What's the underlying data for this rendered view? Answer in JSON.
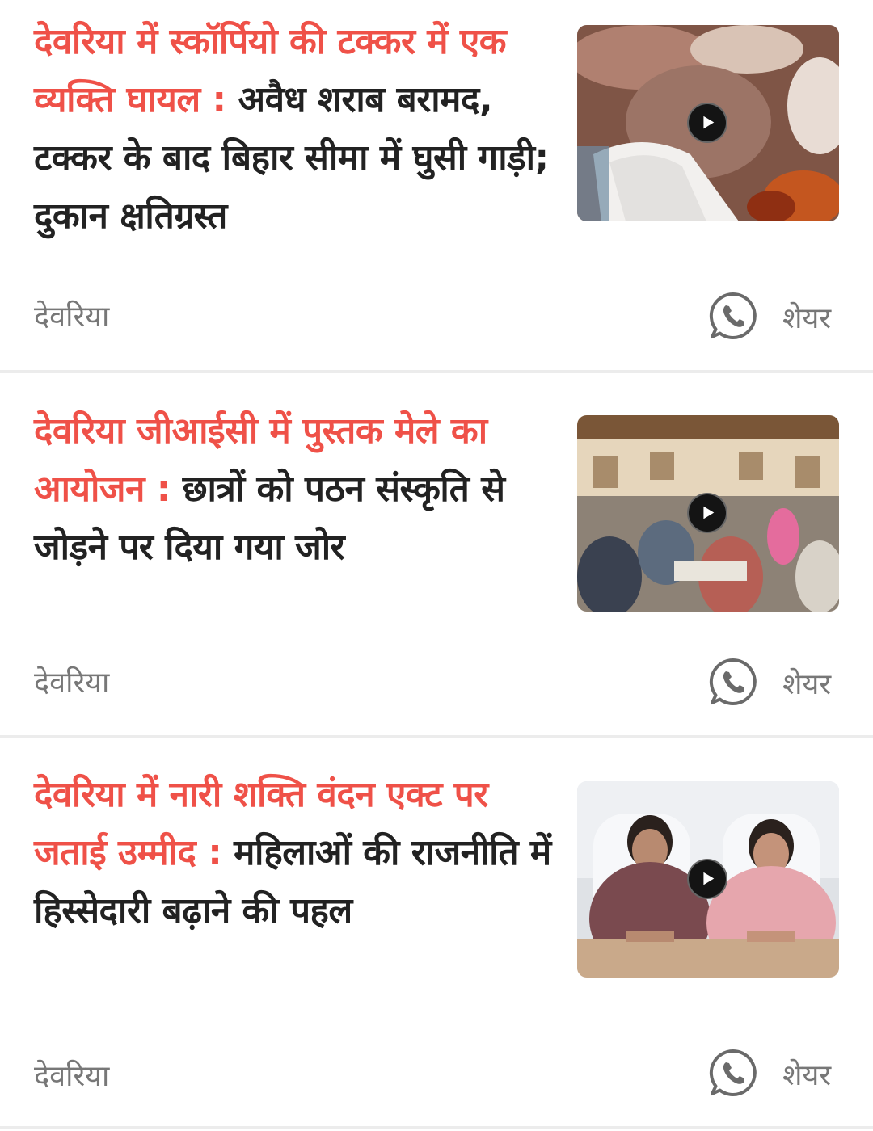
{
  "articles": [
    {
      "highlight": "देवरिया में स्कॉर्पियो की टक्कर में एक व्यक्ति घायल :",
      "rest": "अवैध शराब बरामद, टक्कर के बाद बिहार सीमा में घुसी गाड़ी; दुकान क्षतिग्रस्त",
      "category": "देवरिया",
      "share_label": "शेयर",
      "thumb_icon": "play-icon"
    },
    {
      "highlight": "देवरिया जीआईसी में पुस्तक मेले का आयोजन :",
      "rest": "छात्रों को पठन संस्कृति से जोड़ने पर दिया गया जोर",
      "category": "देवरिया",
      "share_label": "शेयर",
      "thumb_icon": "play-icon"
    },
    {
      "highlight": "देवरिया में नारी शक्ति वंदन एक्ट पर जताई उम्मीद :",
      "rest": "महिलाओं की राजनीति में हिस्सेदारी बढ़ाने की पहल",
      "category": "देवरिया",
      "share_label": "शेयर",
      "thumb_icon": "play-icon"
    }
  ],
  "colors": {
    "highlight": "#ef5148",
    "text": "#222222",
    "muted": "#777777",
    "divider": "#ececec"
  }
}
